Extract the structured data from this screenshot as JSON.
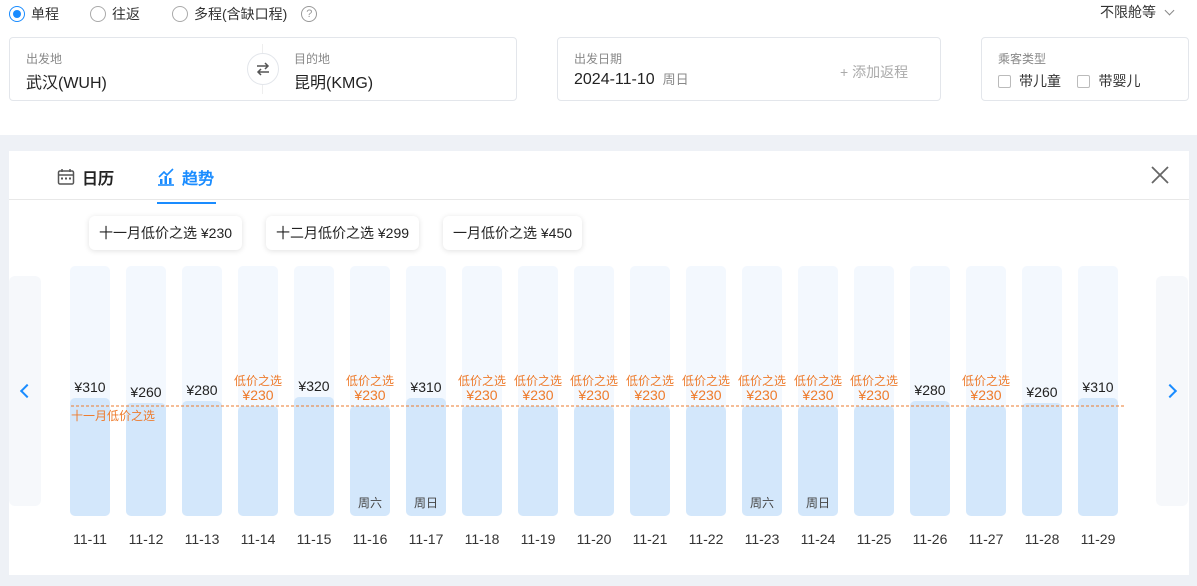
{
  "trip_type": {
    "options": [
      {
        "label": "单程",
        "checked": true
      },
      {
        "label": "往返",
        "checked": false
      },
      {
        "label": "多程(含缺口程)",
        "checked": false
      }
    ],
    "help_icon": "question-circle-icon",
    "cabin": "不限舱等"
  },
  "search": {
    "from_label": "出发地",
    "from_value": "武汉(WUH)",
    "swap_icon": "swap-arrows-icon",
    "to_label": "目的地",
    "to_value": "昆明(KMG)",
    "date_label": "出发日期",
    "date_value": "2024-11-10",
    "date_weekday": "周日",
    "add_return": "+ 添加返程",
    "passenger_label": "乘客类型",
    "child_label": "带儿童",
    "infant_label": "带婴儿"
  },
  "tabs": {
    "calendar": "日历",
    "trend": "趋势",
    "active": "trend"
  },
  "best_prices": [
    "十一月低价之选 ¥230",
    "十二月低价之选 ¥299",
    "一月低价之选 ¥450"
  ],
  "colors": {
    "accent": "#1a8cff",
    "low_price": "#ee7b2c",
    "bar_fill": "#d3e7fb",
    "bar_track": "#f3f8fe"
  },
  "chart_data": {
    "type": "bar",
    "categories": [
      "11-11",
      "11-12",
      "11-13",
      "11-14",
      "11-15",
      "11-16",
      "11-17",
      "11-18",
      "11-19",
      "11-20",
      "11-21",
      "11-22",
      "11-23",
      "11-24",
      "11-25",
      "11-26",
      "11-27",
      "11-28",
      "11-29"
    ],
    "values": [
      310,
      260,
      280,
      230,
      320,
      230,
      310,
      230,
      230,
      230,
      230,
      230,
      230,
      230,
      230,
      280,
      230,
      260,
      310
    ],
    "value_labels": [
      "¥310",
      "¥260",
      "¥280",
      "¥230",
      "¥320",
      "¥230",
      "¥310",
      "¥230",
      "¥230",
      "¥230",
      "¥230",
      "¥230",
      "¥230",
      "¥230",
      "¥230",
      "¥280",
      "¥230",
      "¥260",
      "¥310"
    ],
    "low_flag": [
      false,
      false,
      false,
      true,
      false,
      true,
      false,
      true,
      true,
      true,
      true,
      true,
      true,
      true,
      true,
      false,
      true,
      false,
      false
    ],
    "low_tag": "低价之选",
    "weekday_labels": [
      "",
      "",
      "",
      "",
      "",
      "周六",
      "周日",
      "",
      "",
      "",
      "",
      "",
      "周六",
      "周日",
      "",
      "",
      "",
      "",
      ""
    ],
    "reference_line": {
      "value": 230,
      "label": "十一月低价之选"
    }
  }
}
